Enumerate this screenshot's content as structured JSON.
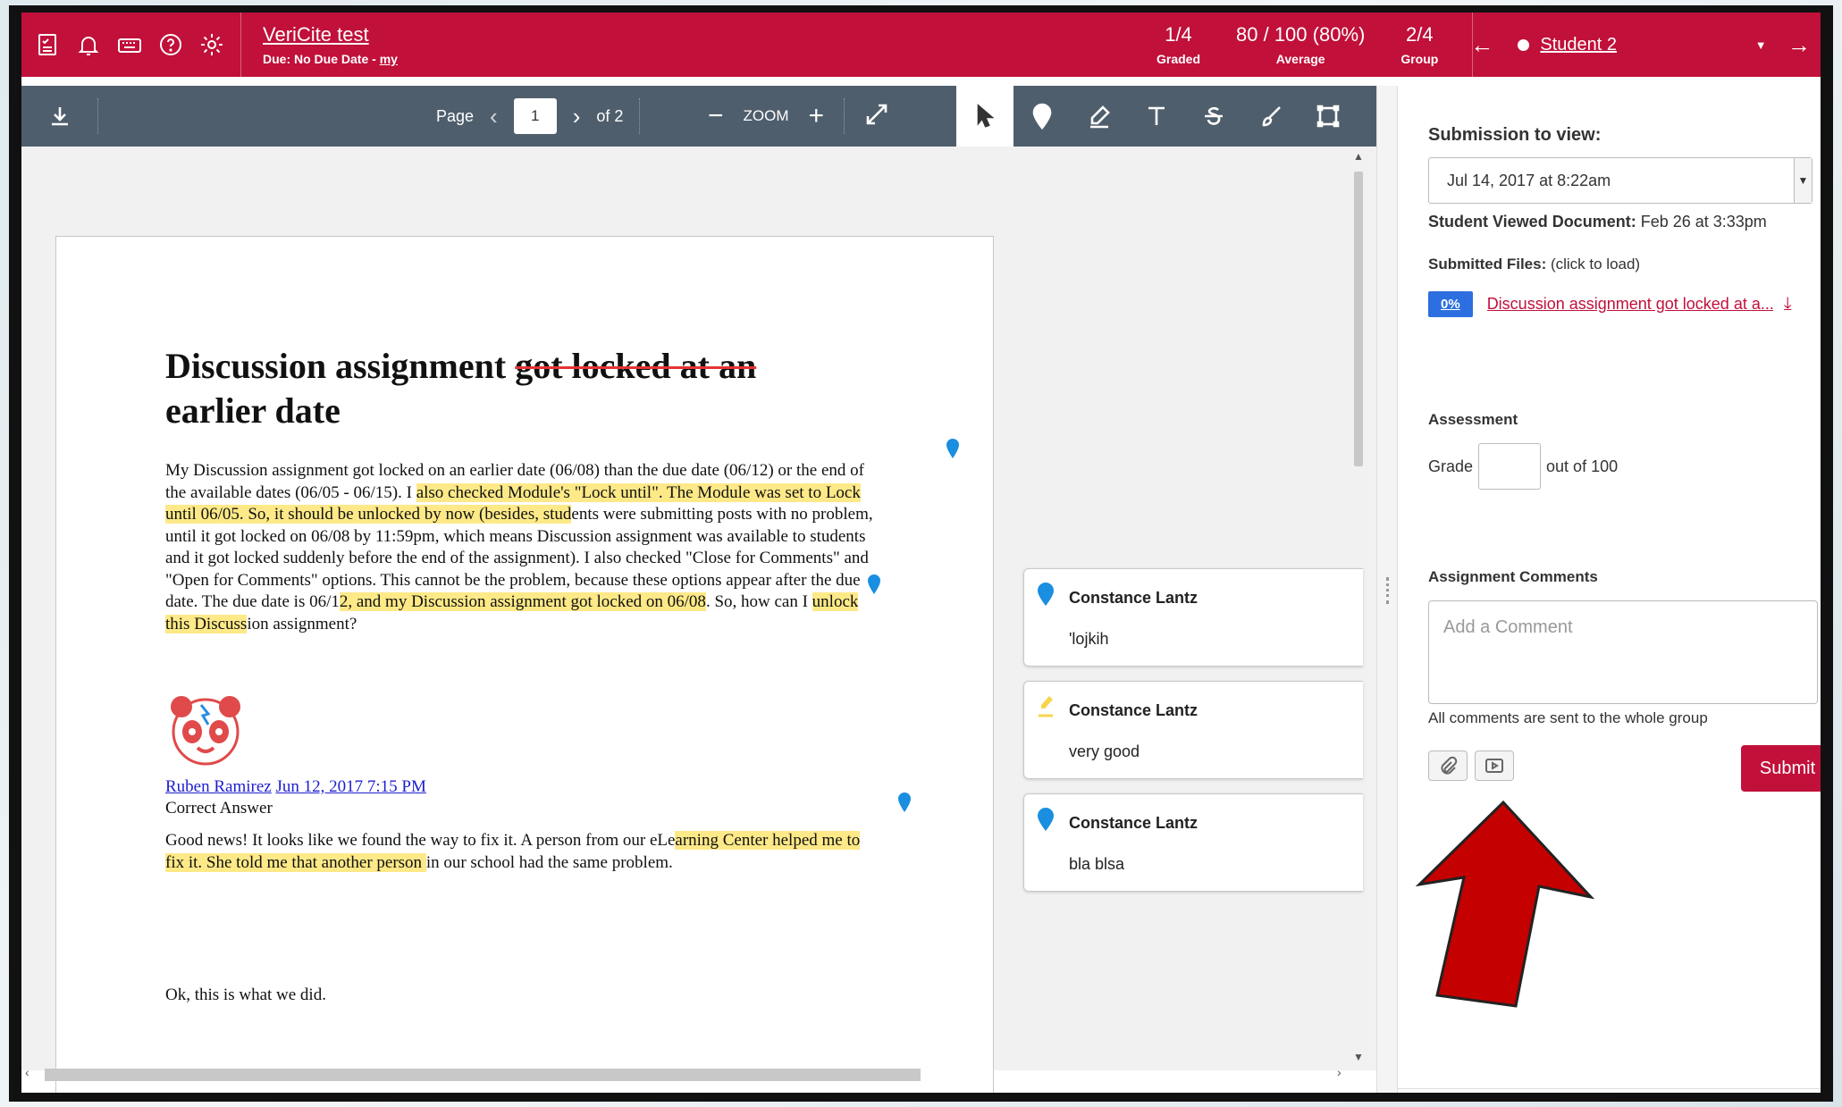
{
  "topbar": {
    "assignment_name": "VeriCite test",
    "due_prefix": "Due: No Due Date - ",
    "due_link": "my",
    "stats": [
      {
        "value": "1/4",
        "label": "Graded"
      },
      {
        "value": "80 / 100 (80%)",
        "label": "Average"
      },
      {
        "value": "2/4",
        "label": "Group"
      }
    ],
    "prev_arrow": "←",
    "next_arrow": "→",
    "student_name": "Student 2",
    "caret": "▼"
  },
  "doc_toolbar": {
    "page_label": "Page",
    "prev": "‹",
    "page_value": "1",
    "next": "›",
    "of_pages": "of 2",
    "zoom_minus": "−",
    "zoom_label": "ZOOM",
    "zoom_plus": "+"
  },
  "document": {
    "title_plain": "Discussion assignment ",
    "title_struck": "got locked at an",
    "title_line2": "earlier date",
    "p1_a": "My Discussion assignment got locked on an earlier date (06/08) than the due date (06/12) or the end of the available dates (06/05 - 06/15).  I ",
    "p1_hl1": "also checked Module's \"Lock until\".  The Module was set to Lock until 06/05.  So, it should be unlocked by now (besides, stud",
    "p1_b": "ents were submitting posts with no problem, until it got locked on 06/08 by 11:59pm, which means Discussion assignment was available to students and it got locked suddenly before the end of the assignment).  I also checked \"Close for Comments\" and \"Open for Comments\" options.  This cannot be the problem, because these options appear after the due date.  The due date is 06/1",
    "p1_hl2": "2, and my Discussion assignment got locked on 06/08",
    "p1_c": ".  So, how can I ",
    "p1_hl3": "unlock this Discuss",
    "p1_d": "ion assignment?",
    "author_name": "Ruben Ramirez",
    "author_date": "Jun 12, 2017 7:15 PM",
    "correct_answer": "Correct Answer",
    "p2_a": "Good news!  It looks like we found the way to fix it.  A person from our eLe",
    "p2_hl": "arning Center helped me to fix it.  She told me that another person ",
    "p2_b": "in our school had the same problem.",
    "p3": "Ok, this is what we did."
  },
  "comments": [
    {
      "author": "Constance Lantz",
      "text": "'lojkih",
      "kind": "point"
    },
    {
      "author": "Constance Lantz",
      "text": "very good",
      "kind": "highlight"
    },
    {
      "author": "Constance Lantz",
      "text": "bla blsa",
      "kind": "point"
    }
  ],
  "sidebar": {
    "submission_label": "Submission to view:",
    "submission_value": "Jul 14, 2017 at 8:22am",
    "viewed_label": "Student Viewed Document:",
    "viewed_value": " Feb 26 at 3:33pm",
    "files_label": "Submitted Files:",
    "files_hint": " (click to load)",
    "file_badge": "0%",
    "file_name": "Discussion assignment got locked at a...",
    "assessment_label": "Assessment",
    "grade_label": "Grade",
    "grade_out_of": "out of 100",
    "comments_label": "Assignment Comments",
    "comment_placeholder": "Add a Comment",
    "whole_group_note": "All comments are sent to the whole group",
    "submit_label": "Submit"
  },
  "colors": {
    "brand": "#c1103a",
    "toolbar": "#4f5e6c",
    "highlight": "#fde987",
    "pin_blue": "#1a8ee0",
    "arrow_red": "#c40000"
  }
}
